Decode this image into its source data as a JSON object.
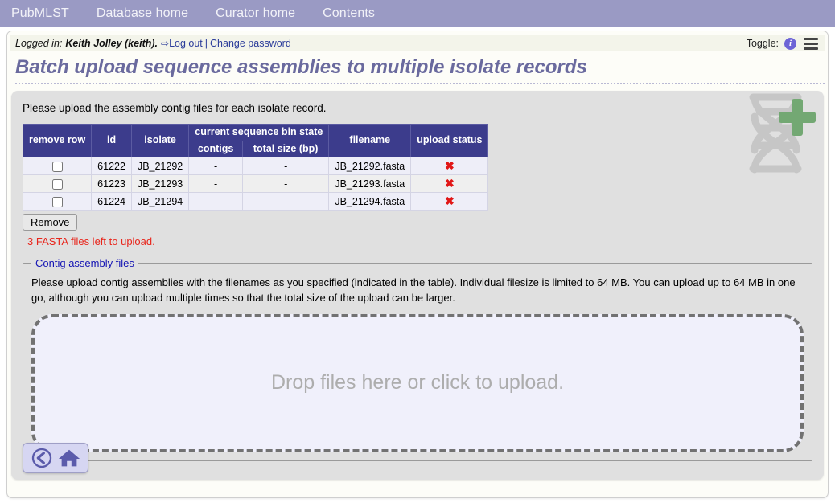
{
  "navbar": {
    "items": [
      {
        "label": "PubMLST",
        "name": "nav-pubmlst"
      },
      {
        "label": "Database home",
        "name": "nav-database-home"
      },
      {
        "label": "Curator home",
        "name": "nav-curator-home"
      },
      {
        "label": "Contents",
        "name": "nav-contents"
      }
    ]
  },
  "loginbar": {
    "logged_in_label": "Logged in:",
    "user": "Keith Jolley (keith).",
    "logout_label": "Log out",
    "separator": "|",
    "change_password_label": "Change password",
    "toggle_label": "Toggle:",
    "info_glyph": "i"
  },
  "page": {
    "title": "Batch upload sequence assemblies to multiple isolate records",
    "intro": "Please upload the assembly contig files for each isolate record."
  },
  "table": {
    "headers": {
      "remove_row": "remove row",
      "id": "id",
      "isolate": "isolate",
      "current_bin_state": "current sequence bin state",
      "contigs": "contigs",
      "total_size": "total size (bp)",
      "filename": "filename",
      "upload_status": "upload status"
    },
    "rows": [
      {
        "id": "61222",
        "isolate": "JB_21292",
        "contigs": "-",
        "total_size": "-",
        "filename": "JB_21292.fasta",
        "upload_status": "✖"
      },
      {
        "id": "61223",
        "isolate": "JB_21293",
        "contigs": "-",
        "total_size": "-",
        "filename": "JB_21293.fasta",
        "upload_status": "✖"
      },
      {
        "id": "61224",
        "isolate": "JB_21294",
        "contigs": "-",
        "total_size": "-",
        "filename": "JB_21294.fasta",
        "upload_status": "✖"
      }
    ],
    "remove_button": "Remove",
    "files_left_message": "3 FASTA files left to upload."
  },
  "fieldset": {
    "legend": "Contig assembly files",
    "description": "Please upload contig assemblies with the filenames as you specified (indicated in the table). Individual filesize is limited to 64 MB. You can upload up to 64 MB in one go, although you can upload multiple times so that the total size of the upload can be larger."
  },
  "dropzone": {
    "text": "Drop files here or click to upload."
  },
  "bottom_nav": {
    "back_label": "Back",
    "home_label": "Home"
  },
  "colors": {
    "navbar_bg": "#9a9ac4",
    "title_text": "#6a6a9e",
    "table_header_bg": "#3c3c8c",
    "error_text": "#e8261c",
    "link": "#2b3c9a",
    "legend_text": "#1414b4",
    "dna_green": "#6aa46a",
    "dna_grey": "#c4c4c4"
  }
}
